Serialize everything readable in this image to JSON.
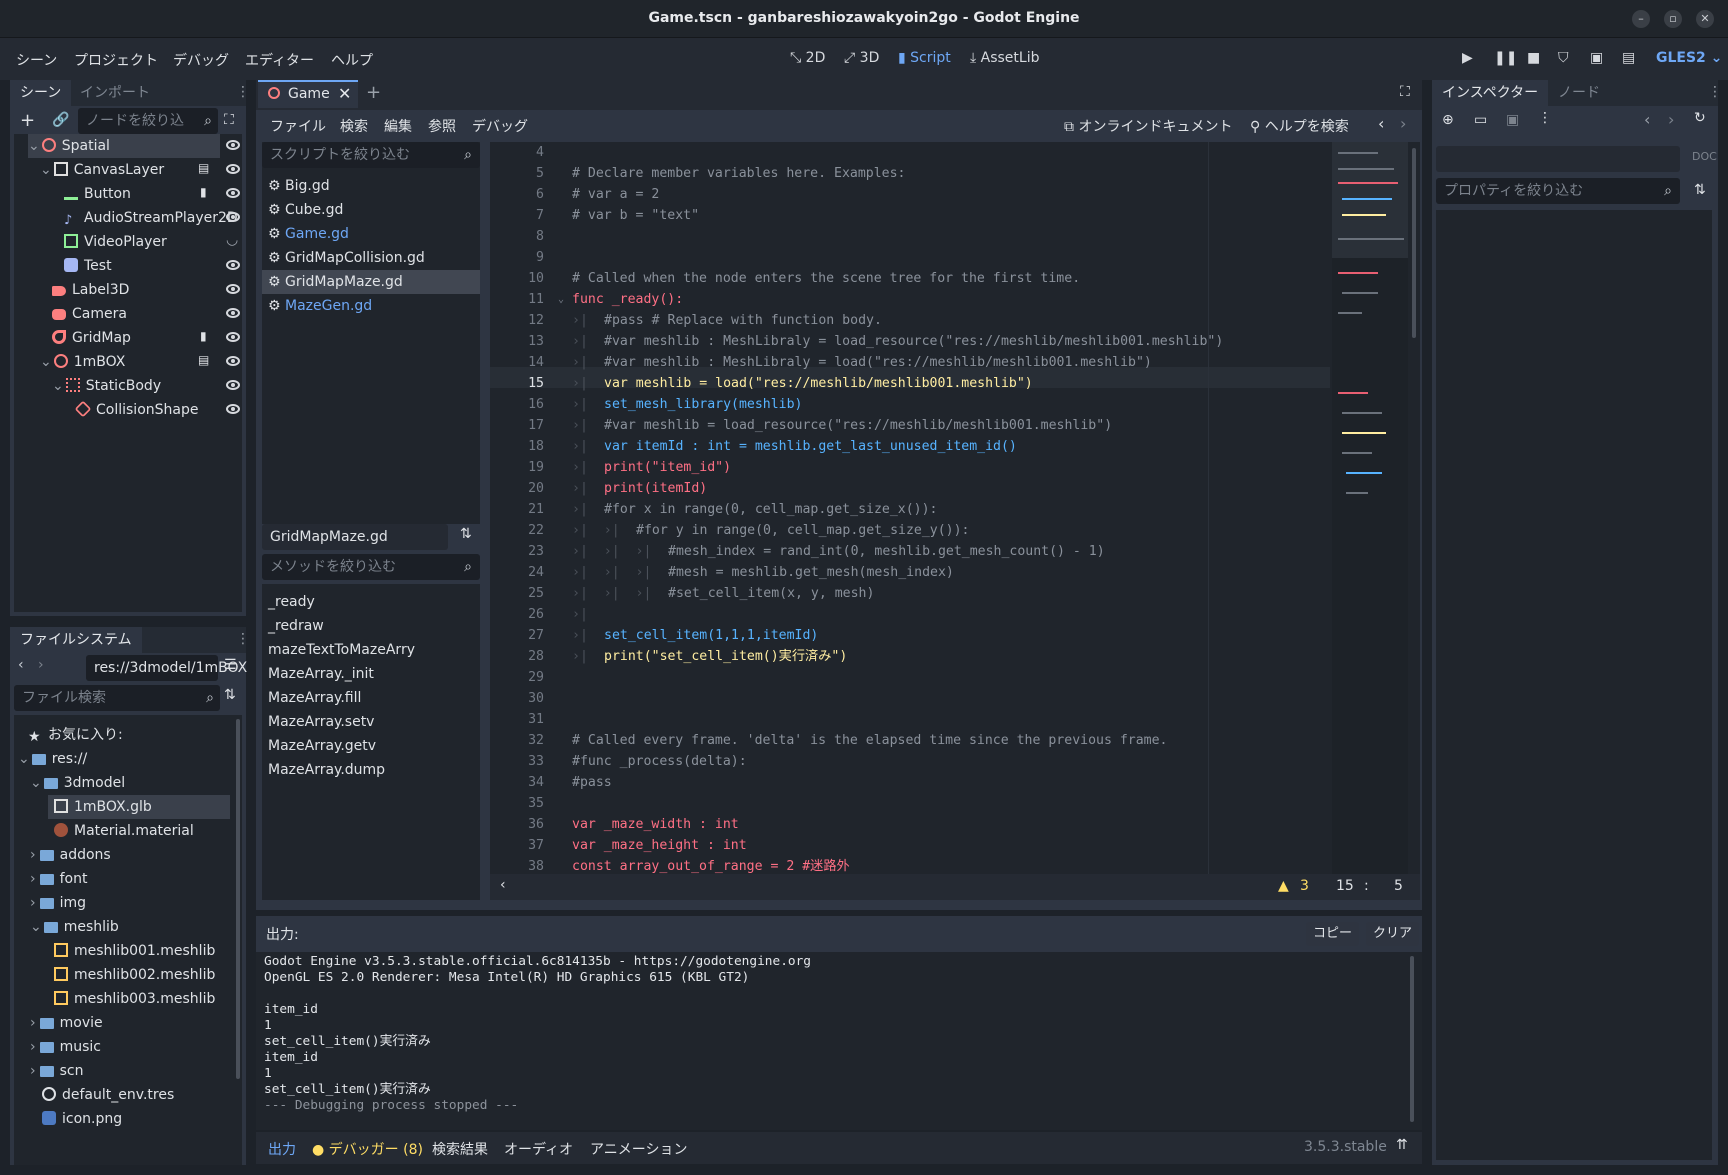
{
  "window": {
    "title": "Game.tscn - ganbareshiozawakyoin2go - Godot Engine"
  },
  "menubar": {
    "items": [
      "シーン",
      "プロジェクト",
      "デバッグ",
      "エディター",
      "ヘルプ"
    ],
    "modes": [
      {
        "label": "2D",
        "icon": "2d-icon"
      },
      {
        "label": "3D",
        "icon": "3d-icon"
      },
      {
        "label": "Script",
        "icon": "script-icon"
      },
      {
        "label": "AssetLib",
        "icon": "assetlib-icon"
      }
    ],
    "renderer": "GLES2"
  },
  "scene_dock": {
    "tabs": [
      "シーン",
      "インポート"
    ],
    "filter_placeholder": "ノードを絞り込",
    "nodes": [
      {
        "label": "Spatial",
        "icon": "spatial-node-icon",
        "color": "#fc7f7f"
      },
      {
        "label": "CanvasLayer",
        "icon": "canvaslayer-node-icon",
        "color": "#e0e0e0"
      },
      {
        "label": "Button",
        "icon": "button-node-icon",
        "color": "#8eef97"
      },
      {
        "label": "AudioStreamPlayer2D",
        "icon": "audio-node-icon",
        "color": "#a5b7f3"
      },
      {
        "label": "VideoPlayer",
        "icon": "video-node-icon",
        "color": "#8eef97"
      },
      {
        "label": "Test",
        "icon": "control-node-icon",
        "color": "#a5b7f3"
      },
      {
        "label": "Label3D",
        "icon": "label3d-node-icon",
        "color": "#fc7f7f"
      },
      {
        "label": "Camera",
        "icon": "camera-node-icon",
        "color": "#fc7f7f"
      },
      {
        "label": "GridMap",
        "icon": "gridmap-node-icon",
        "color": "#fc7f7f"
      },
      {
        "label": "1mBOX",
        "icon": "spatial-node-icon",
        "color": "#fc7f7f"
      },
      {
        "label": "StaticBody",
        "icon": "staticbody-node-icon",
        "color": "#fc7f7f"
      },
      {
        "label": "CollisionShape",
        "icon": "collisionshape-node-icon",
        "color": "#fc7f7f"
      }
    ]
  },
  "filesystem_dock": {
    "tab": "ファイルシステム",
    "path": "res://3dmodel/1mBOX",
    "search_placeholder": "ファイル検索",
    "items": [
      {
        "label": "お気に入り:",
        "icon": "star-icon"
      },
      {
        "label": "res://",
        "icon": "folder-icon"
      },
      {
        "label": "3dmodel",
        "icon": "folder-icon"
      },
      {
        "label": "1mBOX.glb",
        "icon": "scene-file-icon"
      },
      {
        "label": "Material.material",
        "icon": "material-icon"
      },
      {
        "label": "addons",
        "icon": "folder-icon"
      },
      {
        "label": "font",
        "icon": "folder-icon"
      },
      {
        "label": "img",
        "icon": "folder-icon"
      },
      {
        "label": "meshlib",
        "icon": "folder-icon"
      },
      {
        "label": "meshlib001.meshlib",
        "icon": "meshlib-icon"
      },
      {
        "label": "meshlib002.meshlib",
        "icon": "meshlib-icon"
      },
      {
        "label": "meshlib003.meshlib",
        "icon": "meshlib-icon"
      },
      {
        "label": "movie",
        "icon": "folder-icon"
      },
      {
        "label": "music",
        "icon": "folder-icon"
      },
      {
        "label": "scn",
        "icon": "folder-icon"
      },
      {
        "label": "default_env.tres",
        "icon": "environment-icon"
      },
      {
        "label": "icon.png",
        "icon": "image-icon"
      }
    ]
  },
  "script_editor": {
    "scene_tab": "Game",
    "menu": [
      "ファイル",
      "検索",
      "編集",
      "参照",
      "デバッグ"
    ],
    "online_docs": "オンラインドキュメント",
    "help_search": "ヘルプを検索",
    "script_filter_placeholder": "スクリプトを絞り込む",
    "scripts": [
      "Big.gd",
      "Cube.gd",
      "Game.gd",
      "GridMapCollision.gd",
      "GridMapMaze.gd",
      "MazeGen.gd"
    ],
    "current_script": "GridMapMaze.gd",
    "method_filter_placeholder": "メソッドを絞り込む",
    "methods": [
      "_ready",
      "_redraw",
      "mazeTextToMazeArry",
      "MazeArray._init",
      "MazeArray.fill",
      "MazeArray.setv",
      "MazeArray.getv",
      "MazeArray.dump"
    ],
    "status": {
      "warnings": "3",
      "line": "15",
      "col": "5"
    }
  },
  "code": {
    "lines": [
      {
        "n": "4",
        "text": ""
      },
      {
        "n": "5",
        "text": "# Declare member variables here. Examples:"
      },
      {
        "n": "6",
        "text": "# var a = 2"
      },
      {
        "n": "7",
        "text": "# var b = \"text\""
      },
      {
        "n": "8",
        "text": ""
      },
      {
        "n": "9",
        "text": ""
      },
      {
        "n": "10",
        "text": "# Called when the node enters the scene tree for the first time."
      },
      {
        "n": "11",
        "text": "func _ready():"
      },
      {
        "n": "12",
        "text": "#pass # Replace with function body."
      },
      {
        "n": "13",
        "text": "#var meshlib : MeshLibraly = load_resource(\"res://meshlib/meshlib001.meshlib\")"
      },
      {
        "n": "14",
        "text": "#var meshlib : MeshLibraly = load(\"res://meshlib/meshlib001.meshlib\")"
      },
      {
        "n": "15",
        "text": "var meshlib = load(\"res://meshlib/meshlib001.meshlib\")"
      },
      {
        "n": "16",
        "text": "set_mesh_library(meshlib)"
      },
      {
        "n": "17",
        "text": "#var meshlib = load_resource(\"res://meshlib/meshlib001.meshlib\")"
      },
      {
        "n": "18",
        "text": "var itemId : int = meshlib.get_last_unused_item_id()"
      },
      {
        "n": "19",
        "text": "print(\"item_id\")"
      },
      {
        "n": "20",
        "text": "print(itemId)"
      },
      {
        "n": "21",
        "text": "#for x in range(0, cell_map.get_size_x()):"
      },
      {
        "n": "22",
        "text": "#for y in range(0, cell_map.get_size_y()):"
      },
      {
        "n": "23",
        "text": "#mesh_index = rand_int(0, meshlib.get_mesh_count() - 1)"
      },
      {
        "n": "24",
        "text": "#mesh = meshlib.get_mesh(mesh_index)"
      },
      {
        "n": "25",
        "text": "#set_cell_item(x, y, mesh)"
      },
      {
        "n": "26",
        "text": ""
      },
      {
        "n": "27",
        "text": "set_cell_item(1,1,1,itemId)"
      },
      {
        "n": "28",
        "text": "print(\"set_cell_item()実行済み\")"
      },
      {
        "n": "29",
        "text": ""
      },
      {
        "n": "30",
        "text": ""
      },
      {
        "n": "31",
        "text": ""
      },
      {
        "n": "32",
        "text": "# Called every frame. 'delta' is the elapsed time since the previous frame."
      },
      {
        "n": "33",
        "text": "#func _process(delta):"
      },
      {
        "n": "34",
        "text": "#pass"
      },
      {
        "n": "35",
        "text": ""
      },
      {
        "n": "36",
        "text": "var _maze_width : int"
      },
      {
        "n": "37",
        "text": "var _maze_height : int"
      },
      {
        "n": "38",
        "text": "const array_out_of_range = 2 #迷路外"
      }
    ]
  },
  "output": {
    "label": "出力:",
    "copy": "コピー",
    "clear": "クリア",
    "lines": [
      "Godot Engine v3.5.3.stable.official.6c814135b - https://godotengine.org",
      "OpenGL ES 2.0 Renderer: Mesa Intel(R) HD Graphics 615 (KBL GT2)",
      "",
      "item_id",
      "1",
      "set_cell_item()実行済み",
      "item_id",
      "1",
      "set_cell_item()実行済み",
      "--- Debugging process stopped ---"
    ]
  },
  "bottom_tabs": [
    "出力",
    "デバッガー (8)",
    "検索結果",
    "オーディオ",
    "アニメーション"
  ],
  "version": "3.5.3.stable",
  "inspector": {
    "tabs": [
      "インスペクター",
      "ノード"
    ],
    "filter_placeholder": "プロパティを絞り込む"
  },
  "colors": {
    "accent": "#6ea7f5",
    "warning": "#ffdd65",
    "background": "#1d2229"
  }
}
